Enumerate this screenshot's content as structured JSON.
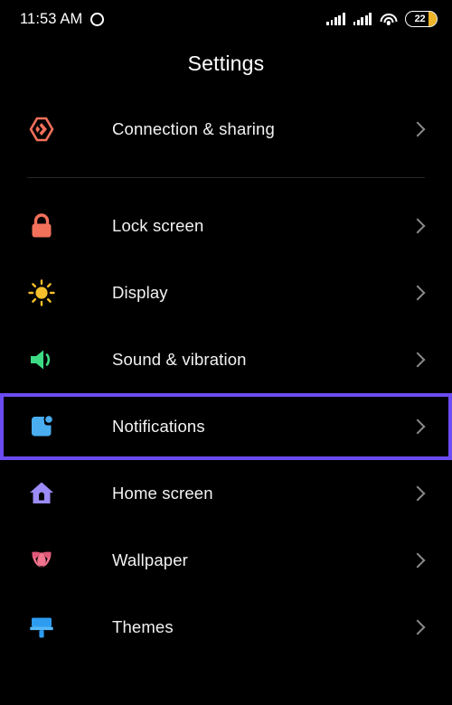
{
  "statusbar": {
    "time": "11:53 AM",
    "camera_icon": "punch-hole-camera",
    "signal1_icon": "cellular-signal-icon",
    "signal2_icon": "cellular-signal-icon",
    "wifi_icon": "wifi-icon",
    "battery_level": "22",
    "battery_icon": "battery-icon"
  },
  "header": {
    "title": "Settings"
  },
  "colors": {
    "background": "#000000",
    "text": "#f2f2f2",
    "selection_outline": "#6B4BF2",
    "chevron": "#8a8a8a",
    "divider": "#262626",
    "battery_fill": "#F0B429",
    "connection_icon": "#F3705A",
    "lock_icon": "#F3705A",
    "display_icon": "#F5C02B",
    "sound_icon": "#3DDC84",
    "notifications_icon": "#4AADF0",
    "home_icon": "#9B8CF7",
    "wallpaper_icon": "#F2748F",
    "themes_icon": "#2D9CF0"
  },
  "groups": [
    {
      "items": [
        {
          "label": "Connection & sharing",
          "icon": "connection-sharing-icon",
          "chevron": "chevron-right-icon",
          "selected": false
        }
      ]
    },
    {
      "items": [
        {
          "label": "Lock screen",
          "icon": "lock-icon",
          "chevron": "chevron-right-icon",
          "selected": false
        },
        {
          "label": "Display",
          "icon": "brightness-sun-icon",
          "chevron": "chevron-right-icon",
          "selected": false
        },
        {
          "label": "Sound & vibration",
          "icon": "speaker-icon",
          "chevron": "chevron-right-icon",
          "selected": false
        },
        {
          "label": "Notifications",
          "icon": "notification-badge-icon",
          "chevron": "chevron-right-icon",
          "selected": true
        },
        {
          "label": "Home screen",
          "icon": "home-icon",
          "chevron": "chevron-right-icon",
          "selected": false
        },
        {
          "label": "Wallpaper",
          "icon": "flower-icon",
          "chevron": "chevron-right-icon",
          "selected": false
        },
        {
          "label": "Themes",
          "icon": "paintbrush-icon",
          "chevron": "chevron-right-icon",
          "selected": false
        }
      ]
    }
  ]
}
